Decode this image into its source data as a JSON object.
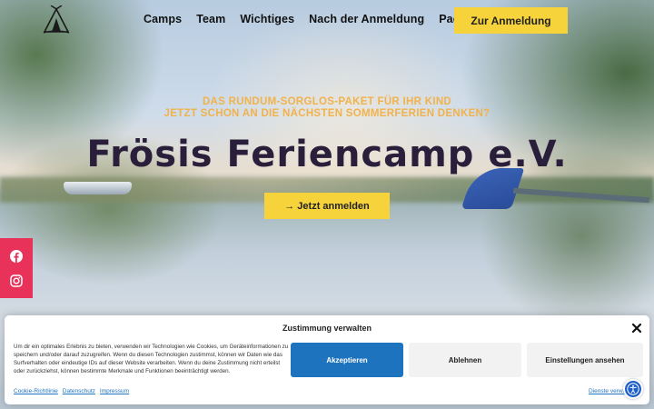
{
  "nav": {
    "items": [
      "Camps",
      "Team",
      "Wichtiges",
      "Nach der Anmeldung",
      "Packliste"
    ],
    "cta": "Zur Anmeldung"
  },
  "hero": {
    "subline1": "DAS RUNDUM-SORGLOS-PAKET FÜR IHR KIND",
    "subline2": "JETZT SCHON AN DIE NÄCHSTEN SOMMERFERIEN DENKEN?",
    "title": "Frösis Feriencamp e.V.",
    "button": "→ Jetzt anmelden"
  },
  "social": {
    "icons": [
      "facebook-icon",
      "instagram-icon"
    ]
  },
  "cookie": {
    "title": "Zustimmung verwalten",
    "text": "Um dir ein optimales Erlebnis zu bieten, verwenden wir Technologien wie Cookies, um Geräteinformationen zu speichern und/oder darauf zuzugreifen. Wenn du diesen Technologien zustimmst, können wir Daten wie das Surfverhalten oder eindeutige IDs auf dieser Website verarbeiten. Wenn du deine Zustimmung nicht erteilst oder zurückziehst, können bestimmte Merkmale und Funktionen beeinträchtigt werden.",
    "accept": "Akzeptieren",
    "deny": "Ablehnen",
    "preferences": "Einstellungen ansehen",
    "links": [
      "Cookie-Richtlinie",
      "Datenschutz",
      "Impressum"
    ],
    "services": "Dienste verwalten"
  },
  "colors": {
    "accent_yellow": "#f6d33b",
    "subline_orange": "#f1b24c",
    "social_pink": "#e8325a",
    "primary_blue": "#1e73be",
    "title_dark": "#2a1f3b"
  }
}
